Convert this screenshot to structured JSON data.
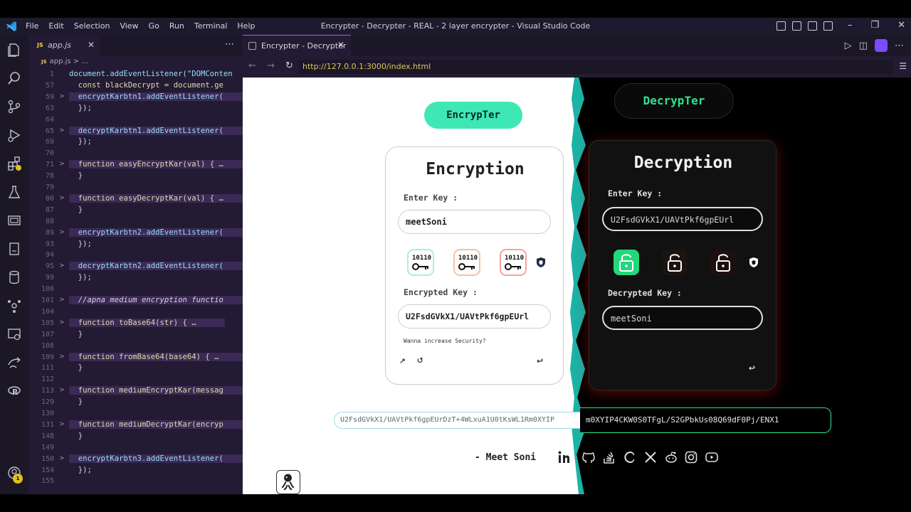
{
  "window": {
    "title": "Encrypter - Decrypter - REAL - 2 layer encrypter - Visual Studio Code",
    "menu": [
      "File",
      "Edit",
      "Selection",
      "View",
      "Go",
      "Run",
      "Terminal",
      "Help"
    ]
  },
  "activity": {
    "accounts_badge": "1"
  },
  "editor": {
    "tab_name": "app.js",
    "tab_lang": "JS",
    "breadcrumb_file": "app.js",
    "breadcrumb_rest": "> ...",
    "lines": [
      {
        "n": "1",
        "t": "document.addEventListener(\"DOMConten",
        "fold": ""
      },
      {
        "n": "57",
        "t": "  const blackDecrypt = document.ge",
        "fold": ""
      },
      {
        "n": "59",
        "t": "  encryptKarbtn1.addEventListener(",
        "fold": ">",
        "hl": true
      },
      {
        "n": "63",
        "t": "  });",
        "fold": ""
      },
      {
        "n": "64",
        "t": "",
        "fold": ""
      },
      {
        "n": "65",
        "t": "  decryptKarbtn1.addEventListener(",
        "fold": ">",
        "hl": true
      },
      {
        "n": "69",
        "t": "  });",
        "fold": ""
      },
      {
        "n": "70",
        "t": "",
        "fold": ""
      },
      {
        "n": "71",
        "t": "  function easyEncryptKar(val) { …",
        "fold": ">",
        "hl": true
      },
      {
        "n": "78",
        "t": "  }",
        "fold": ""
      },
      {
        "n": "79",
        "t": "",
        "fold": ""
      },
      {
        "n": "80",
        "t": "  function easyDecryptKar(val) { …",
        "fold": ">",
        "hl": true
      },
      {
        "n": "87",
        "t": "  }",
        "fold": ""
      },
      {
        "n": "88",
        "t": "",
        "fold": ""
      },
      {
        "n": "89",
        "t": "  encryptKarbtn2.addEventListener(",
        "fold": ">",
        "hl": true
      },
      {
        "n": "93",
        "t": "  });",
        "fold": ""
      },
      {
        "n": "94",
        "t": "",
        "fold": ""
      },
      {
        "n": "95",
        "t": "  decryptKarbtn2.addEventListener(",
        "fold": ">",
        "hl": true
      },
      {
        "n": "99",
        "t": "  });",
        "fold": ""
      },
      {
        "n": "100",
        "t": "",
        "fold": ""
      },
      {
        "n": "101",
        "t": "  //apna medium encryption functio",
        "fold": ">",
        "hl": true,
        "comment": true
      },
      {
        "n": "104",
        "t": "",
        "fold": ""
      },
      {
        "n": "105",
        "t": "  function toBase64(str) { …",
        "fold": ">",
        "hl": true
      },
      {
        "n": "107",
        "t": "  }",
        "fold": ""
      },
      {
        "n": "108",
        "t": "",
        "fold": ""
      },
      {
        "n": "109",
        "t": "  function fromBase64(base64) { …",
        "fold": ">",
        "hl": true
      },
      {
        "n": "111",
        "t": "  }",
        "fold": ""
      },
      {
        "n": "112",
        "t": "",
        "fold": ""
      },
      {
        "n": "113",
        "t": "  function mediumEncryptKar(messag",
        "fold": ">",
        "hl": true
      },
      {
        "n": "129",
        "t": "  }",
        "fold": ""
      },
      {
        "n": "130",
        "t": "",
        "fold": ""
      },
      {
        "n": "131",
        "t": "  function mediumDecryptKar(encryp",
        "fold": ">",
        "hl": true
      },
      {
        "n": "148",
        "t": "  }",
        "fold": ""
      },
      {
        "n": "149",
        "t": "",
        "fold": ""
      },
      {
        "n": "150",
        "t": "  encryptKarbtn3.addEventListener(",
        "fold": ">",
        "hl": true
      },
      {
        "n": "154",
        "t": "  });",
        "fold": ""
      },
      {
        "n": "155",
        "t": "",
        "fold": ""
      }
    ]
  },
  "browser": {
    "tab_title": "Encrypter - Decrypter",
    "url": "http://127.0.0.1:3000/index.html"
  },
  "encrypt": {
    "pill": "EncrypTer",
    "title": "Encryption",
    "key_label": "Enter Key :",
    "key_value": "meetSoni",
    "encrypted_label": "Encrypted Key :",
    "encrypted_value": "U2FsdGVkX1/UAVtPkf6gpEUrl",
    "security_text": "Wanna increase Security?",
    "btn_glyph": "10110"
  },
  "decrypt": {
    "pill": "DecrypTer",
    "title": "Decryption",
    "key_label": "Enter Key :",
    "key_value": "U2FsdGVkX1/UAVtPkf6gpEUrl",
    "decrypted_label": "Decrypted Key :",
    "decrypted_value": "meetSoni"
  },
  "output": {
    "left": "U2FsdGVkX1/UAVtPkf6gpEUrDzT+4WLxuA1U0tKsWL1Rm0XYIP",
    "right": "m0XYIP4CKW0S0TFgL/S2GPbkUs08Q69dF0Pj/ENX1"
  },
  "footer": {
    "author": "- Meet Soni"
  },
  "colors": {
    "accent": "#3ee8b4",
    "green": "#2ee58f",
    "teal": "#1bb3a6",
    "vscode_bg": "#221b33"
  }
}
